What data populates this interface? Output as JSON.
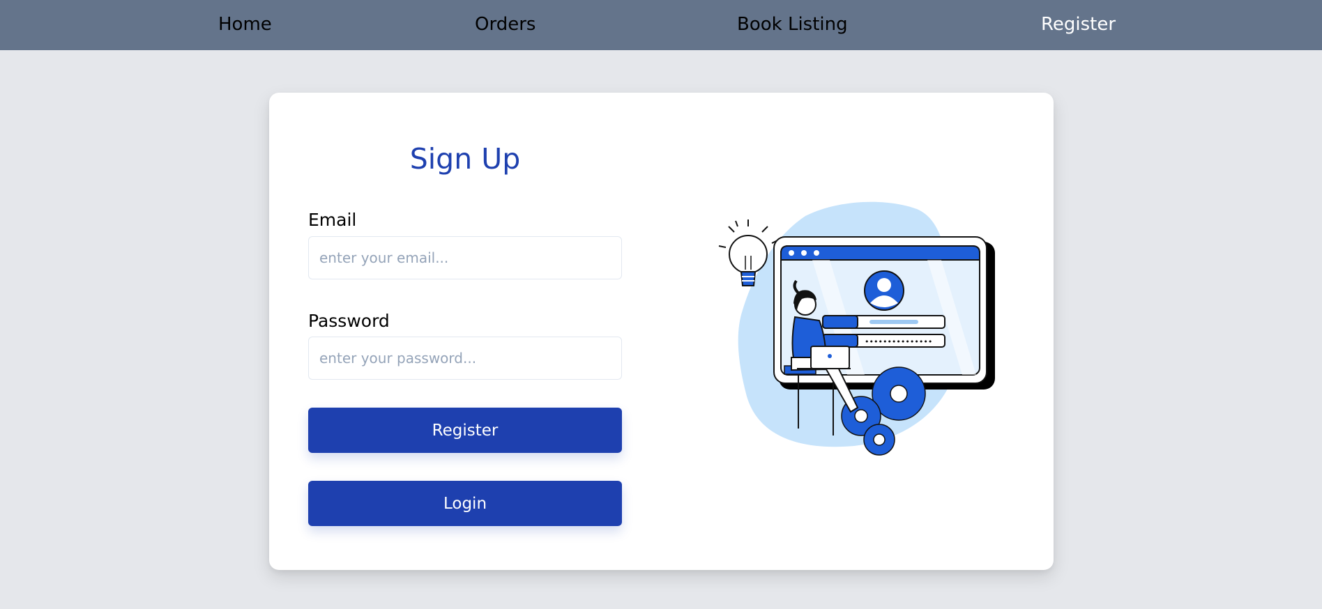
{
  "nav": {
    "home": "Home",
    "orders": "Orders",
    "book_listing": "Book Listing",
    "register": "Register"
  },
  "form": {
    "title": "Sign Up",
    "email_label": "Email",
    "email_placeholder": "enter your email...",
    "password_label": "Password",
    "password_placeholder": "enter your password...",
    "register_button": "Register",
    "login_button": "Login"
  },
  "illustration": {
    "name": "signup-illustration",
    "password_dots": "•••••••••••••••"
  },
  "colors": {
    "navbar": "#64748b",
    "background": "#e5e7eb",
    "primary": "#1e40af",
    "active_nav": "#ffffff"
  }
}
